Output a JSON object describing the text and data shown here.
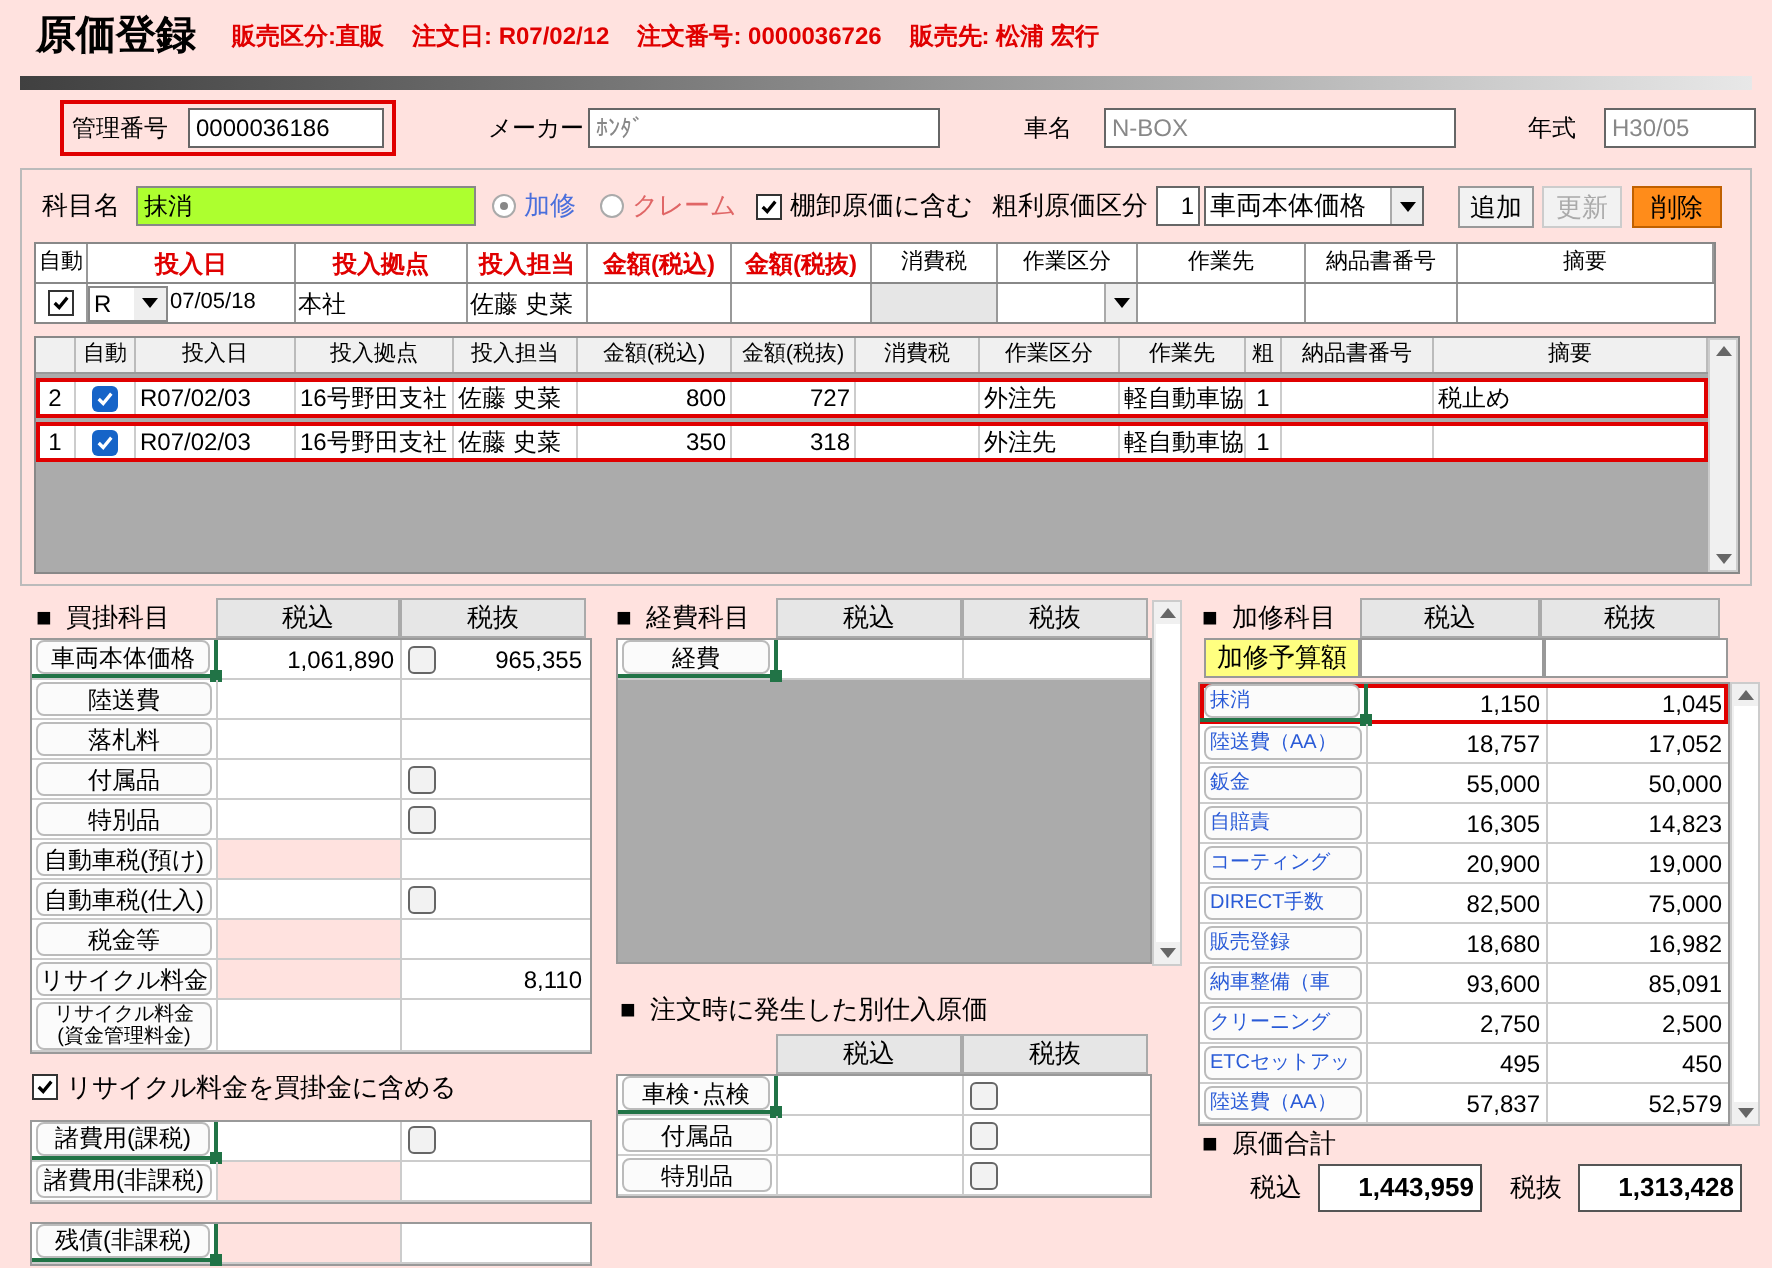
{
  "title": "原価登録",
  "order_info": [
    "販売区分:直販",
    "注文日: R07/02/12",
    "注文番号: 0000036726",
    "販売先: 松浦 宏行"
  ],
  "vehicle_fields": [
    {
      "label": "管理番号",
      "value": "0000036186",
      "disabled": false,
      "highlighted": true
    },
    {
      "label": "メーカー",
      "value": "ﾎﾝﾀﾞ",
      "disabled": true,
      "highlighted": false
    },
    {
      "label": "車名",
      "value": "N-BOX",
      "disabled": true,
      "highlighted": false
    },
    {
      "label": "年式",
      "value": "H30/05",
      "disabled": true,
      "highlighted": false
    }
  ],
  "entry_form": {
    "subject_label": "科目名",
    "subject_value": "抹消",
    "radios": [
      {
        "label": "加修",
        "selected": true
      },
      {
        "label": "クレーム",
        "selected": false
      }
    ],
    "inventory_checkbox": {
      "label": "棚卸原価に含む",
      "checked": true
    },
    "category_label": "粗利原価区分",
    "category_code": "1",
    "category_value": "車両本体価格",
    "buttons": [
      {
        "label": "追加",
        "kind": "normal"
      },
      {
        "label": "更新",
        "kind": "disabled"
      },
      {
        "label": "削除",
        "kind": "danger"
      }
    ]
  },
  "entry_table": {
    "columns": [
      {
        "label": "自動",
        "required": false
      },
      {
        "label": "投入日",
        "required": true
      },
      {
        "label": "投入拠点",
        "required": true
      },
      {
        "label": "投入担当",
        "required": true
      },
      {
        "label": "金額(税込)",
        "required": true
      },
      {
        "label": "金額(税抜)",
        "required": true
      },
      {
        "label": "消費税",
        "required": false
      },
      {
        "label": "作業区分",
        "required": false
      },
      {
        "label": "作業先",
        "required": false
      },
      {
        "label": "納品書番号",
        "required": false
      },
      {
        "label": "摘要",
        "required": false
      }
    ],
    "row": {
      "auto": true,
      "era": "R",
      "date": "07/05/18",
      "base": "本社",
      "staff": "佐藤 史菜"
    }
  },
  "history_grid": {
    "columns": [
      "自動",
      "投入日",
      "投入拠点",
      "投入担当",
      "金額(税込)",
      "金額(税抜)",
      "消費税",
      "作業区分",
      "作業先",
      "粗",
      "納品書番号",
      "摘要"
    ],
    "rows": [
      {
        "no": "2",
        "auto": true,
        "date": "R07/02/03",
        "base": "16号野田支社",
        "staff": "佐藤 史菜",
        "tax_in": "800",
        "tax_ex": "727",
        "work_type": "外注先",
        "vendor": "軽自動車協",
        "coarse": "1",
        "memo": "税止め",
        "highlighted": true
      },
      {
        "no": "1",
        "auto": true,
        "date": "R07/02/03",
        "base": "16号野田支社",
        "staff": "佐藤 史菜",
        "tax_in": "350",
        "tax_ex": "318",
        "work_type": "外注先",
        "vendor": "軽自動車協",
        "coarse": "1",
        "highlighted": true
      }
    ]
  },
  "purchase": {
    "title": "■  買掛科目",
    "columns": [
      "税込",
      "税抜"
    ],
    "rows": [
      {
        "label": "車両本体価格",
        "tax_in": "1,061,890",
        "tax_ex": "965,355",
        "kind": "checkbox",
        "checked": false,
        "shaded": false,
        "selected": true
      },
      {
        "label": "陸送費",
        "kind": "plain",
        "shaded": false,
        "selected": false
      },
      {
        "label": "落札料",
        "kind": "plain",
        "shaded": false,
        "selected": false
      },
      {
        "label": "付属品",
        "kind": "checkbox",
        "checked": false,
        "shaded": false,
        "selected": false
      },
      {
        "label": "特別品",
        "kind": "checkbox",
        "checked": false,
        "shaded": false,
        "selected": false
      },
      {
        "label": "自動車税(預け)",
        "kind": "plain",
        "shaded": true,
        "selected": false
      },
      {
        "label": "自動車税(仕入)",
        "kind": "checkbox",
        "checked": false,
        "shaded": false,
        "selected": false
      },
      {
        "label": "税金等",
        "kind": "plain",
        "shaded": true,
        "selected": false
      },
      {
        "label": "リサイクル料金",
        "tax_ex": "8,110",
        "kind": "plain",
        "shaded": true,
        "selected": false
      },
      {
        "label": "リサイクル料金(資金管理料金)",
        "kind": "tall",
        "shaded": false,
        "selected": false
      }
    ]
  },
  "include_recycle": {
    "label": "リサイクル料金を買掛金に含める",
    "checked": true
  },
  "misc_costs": {
    "rows": [
      {
        "label": "諸費用(課税)",
        "kind": "checkbox",
        "checked": false,
        "shaded": false,
        "selected": true
      },
      {
        "label": "諸費用(非課税)",
        "kind": "plain",
        "shaded": true,
        "selected": false
      }
    ]
  },
  "debt": {
    "rows": [
      {
        "label": "残債(非課税)",
        "shaded": true,
        "selected": true
      }
    ]
  },
  "expenses": {
    "title": "■  経費科目",
    "columns": [
      "税込",
      "税抜"
    ],
    "rows": [
      {
        "label": "経費",
        "shaded": false,
        "selected": true
      }
    ]
  },
  "separate_costs": {
    "title": "■  注文時に発生した別仕入原価",
    "columns": [
      "税込",
      "税抜"
    ],
    "rows": [
      {
        "label": "車検･点検",
        "kind": "checkbox",
        "checked": false,
        "shaded": false,
        "selected": true
      },
      {
        "label": "付属品",
        "kind": "checkbox",
        "checked": false,
        "shaded": false,
        "selected": false
      },
      {
        "label": "特別品",
        "kind": "checkbox",
        "checked": false,
        "shaded": false,
        "selected": false
      }
    ]
  },
  "repair": {
    "title": "■  加修科目",
    "columns": [
      "税込",
      "税抜"
    ],
    "budget_label": "加修予算額",
    "rows": [
      {
        "label": "抹消",
        "tax_in": "1,150",
        "tax_ex": "1,045",
        "highlighted": true,
        "selected": true
      },
      {
        "label": "陸送費（AA）",
        "tax_in": "18,757",
        "tax_ex": "17,052",
        "highlighted": false,
        "selected": false
      },
      {
        "label": "鈑金",
        "tax_in": "55,000",
        "tax_ex": "50,000",
        "highlighted": false,
        "selected": false
      },
      {
        "label": "自賠責",
        "tax_in": "16,305",
        "tax_ex": "14,823",
        "highlighted": false,
        "selected": false
      },
      {
        "label": "コーティング",
        "tax_in": "20,900",
        "tax_ex": "19,000",
        "highlighted": false,
        "selected": false
      },
      {
        "label": "DIRECT手数",
        "tax_in": "82,500",
        "tax_ex": "75,000",
        "highlighted": false,
        "selected": false
      },
      {
        "label": "販売登録",
        "tax_in": "18,680",
        "tax_ex": "16,982",
        "highlighted": false,
        "selected": false
      },
      {
        "label": "納車整備（車",
        "tax_in": "93,600",
        "tax_ex": "85,091",
        "highlighted": false,
        "selected": false
      },
      {
        "label": "クリーニング",
        "tax_in": "2,750",
        "tax_ex": "2,500",
        "highlighted": false,
        "selected": false
      },
      {
        "label": "ETCセットアッ",
        "tax_in": "495",
        "tax_ex": "450",
        "highlighted": false,
        "selected": false
      },
      {
        "label": "陸送費（AA）",
        "tax_in": "57,837",
        "tax_ex": "52,579",
        "highlighted": false,
        "selected": false
      }
    ]
  },
  "totals": {
    "title": "■  原価合計",
    "items": [
      {
        "label": "税込",
        "value": "1,443,959"
      },
      {
        "label": "税抜",
        "value": "1,313,428"
      }
    ]
  }
}
